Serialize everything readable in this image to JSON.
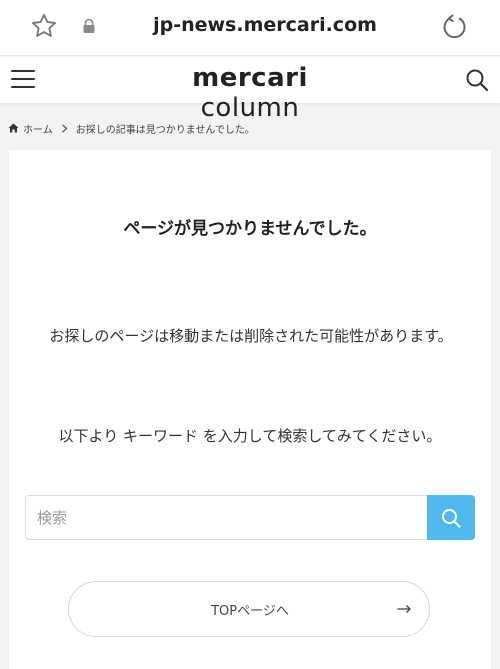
{
  "browser": {
    "url": "jp-news.mercari.com",
    "icons": [
      "star-icon",
      "lock-icon",
      "reload-icon"
    ]
  },
  "header": {
    "logo_bold": "mercari",
    "logo_light": " column",
    "icons": [
      "menu-icon",
      "search-icon"
    ]
  },
  "breadcrumb": {
    "home": "ホーム",
    "current": "お探しの記事は見つかりませんでした。"
  },
  "main": {
    "title": "ページが見つかりませんでした。",
    "message": "お探しのページは移動または削除された可能性があります。",
    "hint": "以下より キーワード を入力して検索してみてください。",
    "search_placeholder": "検索",
    "top_button_label": "TOPページへ"
  },
  "colors": {
    "accent": "#4fb8ec",
    "background": "#f3f3f3",
    "card": "#ffffff"
  }
}
